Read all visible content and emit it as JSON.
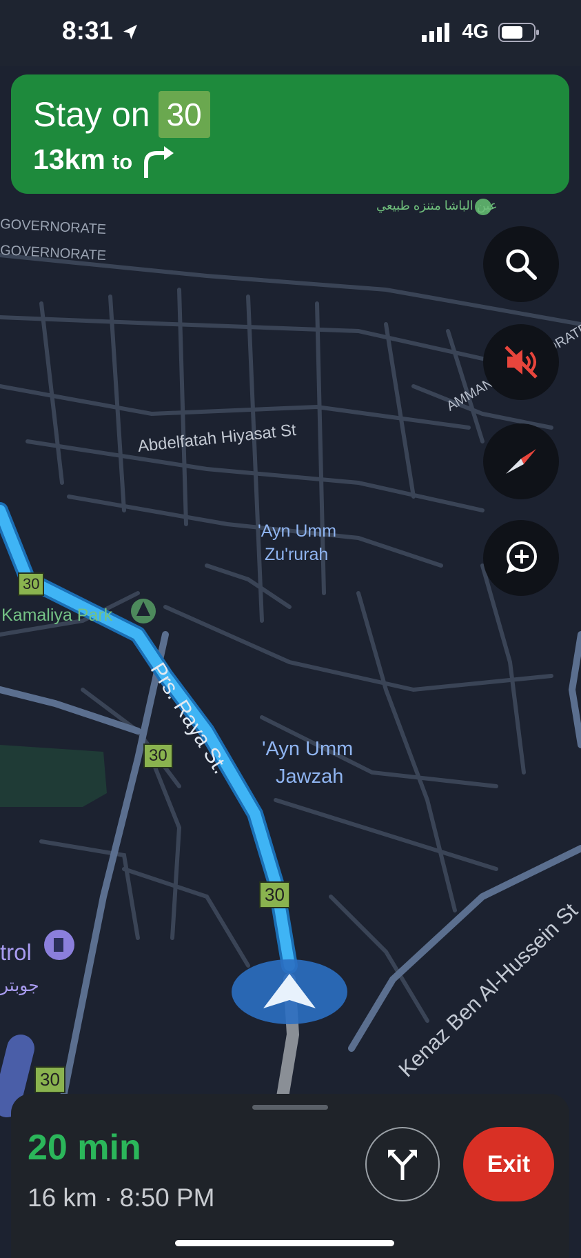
{
  "status": {
    "time": "8:31",
    "network": "4G"
  },
  "navigation": {
    "instruction": "Stay on",
    "route_number": "30",
    "distance": "13km",
    "to_label": "to",
    "icon": "turn-right-icon"
  },
  "map_controls": [
    {
      "name": "search-button",
      "icon": "search-icon"
    },
    {
      "name": "mute-button",
      "icon": "volume-muted-icon"
    },
    {
      "name": "compass-button",
      "icon": "compass-icon"
    },
    {
      "name": "add-report-button",
      "icon": "add-comment-icon"
    }
  ],
  "map_labels": {
    "governorate1": "GOVERNORATE",
    "governorate2": "GOVERNORATE",
    "park_ar": "عين الباشا متنزه طبيعي",
    "amman_gov": "AMMAN GOVERNORATE",
    "street1": "Abdelfatah Hiyasat St",
    "area1_line1": "'Ayn Umm",
    "area1_line2": "Zu'rurah",
    "park": "Kamaliya Park",
    "street2": "Prs. Raya St.",
    "area2_line1": "'Ayn Umm",
    "area2_line2": "Jawzah",
    "petrol": "trol",
    "petrol_ar": "جوبتر",
    "street3": "Kenaz Ben Al-Hussein St",
    "route_shields": [
      "30",
      "30",
      "30",
      "30"
    ]
  },
  "trip": {
    "eta_minutes": "20 min",
    "details": "16 km · 8:50 PM",
    "exit_label": "Exit",
    "alternate_icon": "alternate-routes-icon"
  },
  "colors": {
    "banner_green": "#1e8a3c",
    "route_blue": "#3fb4f5",
    "eta_green": "#2bb65a",
    "exit_red": "#d93025",
    "map_bg": "#1c2230"
  }
}
